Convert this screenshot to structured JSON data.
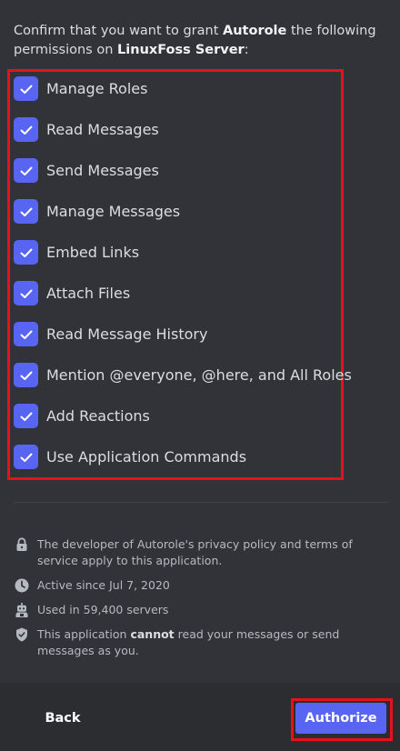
{
  "prompt": {
    "before": "Confirm that you want to grant ",
    "app": "Autorole",
    "middle": " the following permissions on ",
    "server": "LinuxFoss Server",
    "after": ":"
  },
  "permissions": [
    {
      "label": "Manage Roles",
      "checked": true
    },
    {
      "label": "Read Messages",
      "checked": true
    },
    {
      "label": "Send Messages",
      "checked": true
    },
    {
      "label": "Manage Messages",
      "checked": true
    },
    {
      "label": "Embed Links",
      "checked": true
    },
    {
      "label": "Attach Files",
      "checked": true
    },
    {
      "label": "Read Message History",
      "checked": true
    },
    {
      "label": "Mention @everyone, @here, and All Roles",
      "checked": true
    },
    {
      "label": "Add Reactions",
      "checked": true
    },
    {
      "label": "Use Application Commands",
      "checked": true
    }
  ],
  "info": {
    "privacy": "The developer of Autorole's privacy policy and terms of service apply to this application.",
    "active": "Active since Jul 7, 2020",
    "servers": "Used in 59,400 servers",
    "cannot_before": "This application ",
    "cannot_bold": "cannot",
    "cannot_after": " read your messages or send messages as you."
  },
  "footer": {
    "back_label": "Back",
    "authorize_label": "Authorize"
  },
  "colors": {
    "background": "#313338",
    "footer": "#2b2d31",
    "accent": "#5865f2",
    "highlight": "#e8101b"
  }
}
